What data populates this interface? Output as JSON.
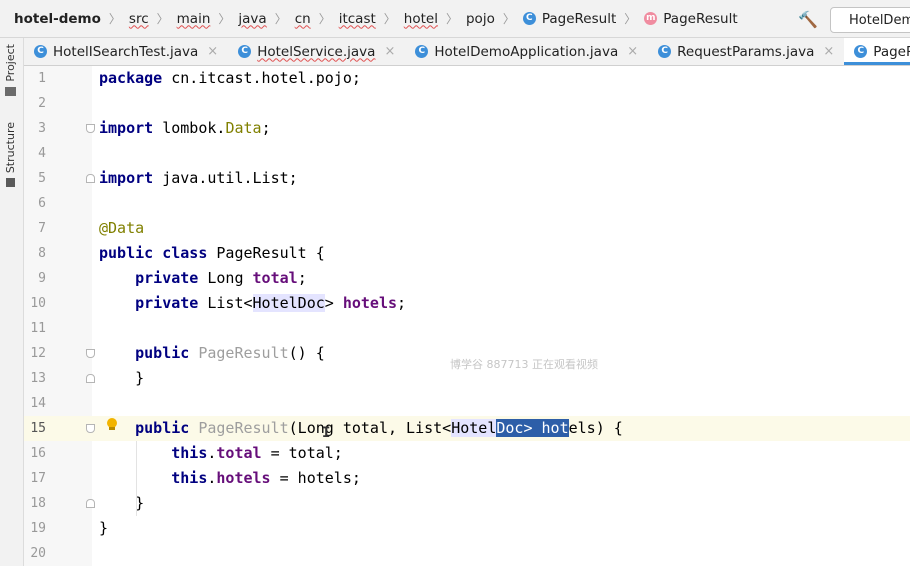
{
  "breadcrumb": {
    "items": [
      {
        "label": "hotel-demo",
        "style": "bold"
      },
      {
        "label": "src",
        "style": "squiggle"
      },
      {
        "label": "main",
        "style": "squiggle"
      },
      {
        "label": "java",
        "style": "squiggle"
      },
      {
        "label": "cn",
        "style": "squiggle"
      },
      {
        "label": "itcast",
        "style": "squiggle"
      },
      {
        "label": "hotel",
        "style": "squiggle"
      },
      {
        "label": "pojo",
        "style": "plain"
      },
      {
        "label": "PageResult",
        "style": "class",
        "icon": "C"
      },
      {
        "label": "PageResult",
        "style": "method",
        "icon": "m"
      }
    ],
    "run_config": "HotelDemoApplication"
  },
  "left_strip": {
    "project_label": "Project",
    "structure_label": "Structure"
  },
  "tabs": [
    {
      "label": "HotelISearchTest.java",
      "active": false,
      "squiggle": false
    },
    {
      "label": "HotelService.java",
      "active": false,
      "squiggle": true
    },
    {
      "label": "HotelDemoApplication.java",
      "active": false,
      "squiggle": false
    },
    {
      "label": "RequestParams.java",
      "active": false,
      "squiggle": false
    },
    {
      "label": "PageResult.java",
      "active": true,
      "squiggle": false
    }
  ],
  "tab_icon": "C",
  "tab_close": "×",
  "watermark": "博学谷 887713 正在观看视频",
  "colors": {
    "keyword": "#000080",
    "field": "#660e7a",
    "annotation": "#808000",
    "selection": "#2d5ea8",
    "tab_underline": "#3d8fd9"
  },
  "code": {
    "current_line": 15,
    "lines": [
      {
        "n": "1",
        "segs": [
          {
            "t": "package",
            "c": "kw"
          },
          {
            "t": " cn.itcast.hotel.pojo;"
          }
        ]
      },
      {
        "n": "2",
        "segs": []
      },
      {
        "n": "3",
        "segs": [
          {
            "t": "import",
            "c": "kw"
          },
          {
            "t": " lombok."
          },
          {
            "t": "Data",
            "c": "ann"
          },
          {
            "t": ";"
          }
        ]
      },
      {
        "n": "4",
        "segs": []
      },
      {
        "n": "5",
        "segs": [
          {
            "t": "import",
            "c": "kw"
          },
          {
            "t": " java.util.List;"
          }
        ]
      },
      {
        "n": "6",
        "segs": []
      },
      {
        "n": "7",
        "segs": [
          {
            "t": "@Data",
            "c": "ann"
          }
        ]
      },
      {
        "n": "8",
        "segs": [
          {
            "t": "public",
            "c": "kw"
          },
          {
            "t": " "
          },
          {
            "t": "class",
            "c": "kw"
          },
          {
            "t": " PageResult {"
          }
        ]
      },
      {
        "n": "9",
        "segs": [
          {
            "t": "    "
          },
          {
            "t": "private",
            "c": "kw"
          },
          {
            "t": " Long "
          },
          {
            "t": "total",
            "c": "fld"
          },
          {
            "t": ";"
          }
        ]
      },
      {
        "n": "10",
        "segs": [
          {
            "t": "    "
          },
          {
            "t": "private",
            "c": "kw"
          },
          {
            "t": " List<"
          },
          {
            "t": "HotelDoc",
            "c": "hl"
          },
          {
            "t": "> "
          },
          {
            "t": "hotels",
            "c": "fld"
          },
          {
            "t": ";"
          }
        ]
      },
      {
        "n": "11",
        "segs": []
      },
      {
        "n": "12",
        "segs": [
          {
            "t": "    "
          },
          {
            "t": "public",
            "c": "kw"
          },
          {
            "t": " "
          },
          {
            "t": "PageResult",
            "c": "unused"
          },
          {
            "t": "() {"
          }
        ]
      },
      {
        "n": "13",
        "segs": [
          {
            "t": "    }"
          }
        ]
      },
      {
        "n": "14",
        "segs": []
      },
      {
        "n": "15",
        "segs": [
          {
            "t": "    "
          },
          {
            "t": "public",
            "c": "kw"
          },
          {
            "t": " "
          },
          {
            "t": "PageResult",
            "c": "unused"
          },
          {
            "t": "(Long total, List<"
          },
          {
            "t": "Hotel",
            "c": "hl"
          },
          {
            "t": "Doc> hot",
            "c": "sel"
          },
          {
            "t": "els) {"
          }
        ]
      },
      {
        "n": "16",
        "segs": [
          {
            "t": "        "
          },
          {
            "t": "this",
            "c": "kw"
          },
          {
            "t": "."
          },
          {
            "t": "total",
            "c": "fld"
          },
          {
            "t": " = total;"
          }
        ]
      },
      {
        "n": "17",
        "segs": [
          {
            "t": "        "
          },
          {
            "t": "this",
            "c": "kw"
          },
          {
            "t": "."
          },
          {
            "t": "hotels",
            "c": "fld"
          },
          {
            "t": " = hotels;"
          }
        ]
      },
      {
        "n": "18",
        "segs": [
          {
            "t": "    }"
          }
        ]
      },
      {
        "n": "19",
        "segs": [
          {
            "t": "}"
          }
        ]
      },
      {
        "n": "20",
        "segs": []
      }
    ]
  }
}
